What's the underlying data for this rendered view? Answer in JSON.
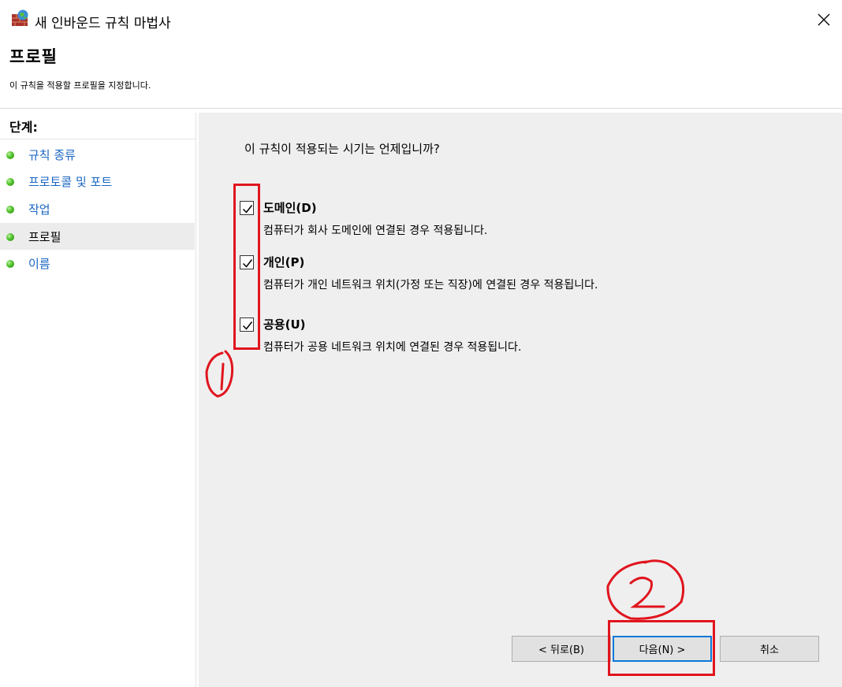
{
  "window": {
    "title": "새 인바운드 규칙 마법사",
    "app_icon": "firewall-wizard-icon",
    "close_icon": "close-x-icon"
  },
  "header": {
    "title": "프로필",
    "description": "이 규칙을 적용할 프로필을 지정합니다."
  },
  "steps": {
    "heading": "단계:",
    "items": [
      {
        "label": "규칙 종류",
        "current": false
      },
      {
        "label": "프로토콜 및 포트",
        "current": false
      },
      {
        "label": "작업",
        "current": false
      },
      {
        "label": "프로필",
        "current": true
      },
      {
        "label": "이름",
        "current": false
      }
    ]
  },
  "main": {
    "question": "이 규칙이 적용되는 시기는 언제입니까?",
    "options": [
      {
        "title": "도메인(D)",
        "description": "컴퓨터가 회사 도메인에 연결된 경우 적용됩니다.",
        "checked": true
      },
      {
        "title": "개인(P)",
        "description": "컴퓨터가 개인 네트워크 위치(가정 또는 직장)에 연결된 경우 적용됩니다.",
        "checked": true
      },
      {
        "title": "공용(U)",
        "description": "컴퓨터가 공용 네트워크 위치에 연결된 경우 적용됩니다.",
        "checked": true
      }
    ]
  },
  "buttons": {
    "back": "< 뒤로(B)",
    "next": "다음(N) >",
    "cancel": "취소"
  },
  "annotations": {
    "color": "#e0151e",
    "marks": [
      "①",
      "②"
    ]
  },
  "colors": {
    "link": "#1a66c2",
    "content_bg": "#efefef",
    "primary_border": "#0a78d7",
    "step_dot": "#4fc22a"
  }
}
